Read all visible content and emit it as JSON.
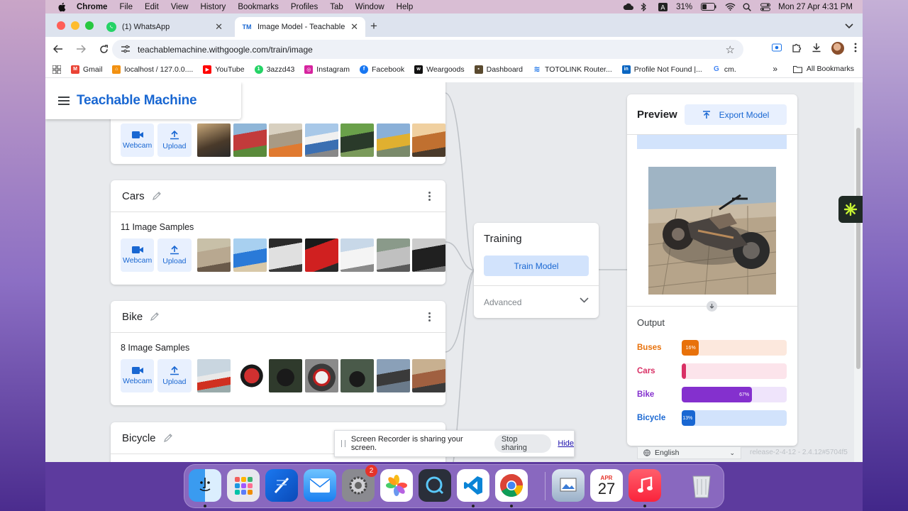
{
  "menubar": {
    "app": "Chrome",
    "items": [
      "File",
      "Edit",
      "View",
      "History",
      "Bookmarks",
      "Profiles",
      "Tab",
      "Window",
      "Help"
    ],
    "battery": "31%",
    "clock": "Mon 27 Apr  4:31 PM"
  },
  "tabs": [
    {
      "title": "(1) WhatsApp",
      "favicon": "whatsapp-icon"
    },
    {
      "title": "Image Model - Teachable Machine",
      "favicon": "teachable-machine-icon",
      "favicon_text": "TM"
    }
  ],
  "address": {
    "url": "teachablemachine.withgoogle.com/train/image"
  },
  "bookmarks": [
    {
      "label": "Gmail",
      "icon": "gmail-icon",
      "color": "#ea4335"
    },
    {
      "label": "localhost / 127.0.0....",
      "icon": "phpmyadmin-icon",
      "color": "#f29111"
    },
    {
      "label": "YouTube",
      "icon": "youtube-icon",
      "color": "#ff0000"
    },
    {
      "label": "3azzd43",
      "icon": "whatsapp-icon",
      "color": "#25d366"
    },
    {
      "label": "Instagram",
      "icon": "instagram-icon",
      "color": "#d6249f"
    },
    {
      "label": "Facebook",
      "icon": "facebook-icon",
      "color": "#1877f2"
    },
    {
      "label": "Weargoods",
      "icon": "weargoods-icon",
      "color": "#111111"
    },
    {
      "label": "Dashboard",
      "icon": "dashboard-icon",
      "color": "#5a4a2f"
    },
    {
      "label": "TOTOLINK Router...",
      "icon": "wifi-icon",
      "color": "#1a73e8"
    },
    {
      "label": "Profile Not Found |...",
      "icon": "linkedin-icon",
      "color": "#0a66c2"
    },
    {
      "label": "cm.",
      "icon": "google-icon",
      "color": "#4285f4"
    }
  ],
  "bookmarks_all": "All Bookmarks",
  "app": {
    "brand": "Teachable Machine"
  },
  "classes": [
    {
      "name": "",
      "samples_label": "",
      "thumbs": [
        "#5a4a3a",
        "#c23b3b",
        "#a89a84",
        "#3b6fb2",
        "#4c7a3a",
        "#b88a2a",
        "#c07030"
      ]
    },
    {
      "name": "Cars",
      "samples_label": "11 Image Samples",
      "thumbs": [
        "#b8a890",
        "#4a8ac8",
        "#e0e0e0",
        "#c83030",
        "#e8e8e8",
        "#b0b0b0",
        "#303030"
      ]
    },
    {
      "name": "Bike",
      "samples_label": "8 Image Samples",
      "thumbs": [
        "#c9d6e0",
        "#d03030",
        "#2f3a2c",
        "#8a8a8a",
        "#4a5a4a",
        "#6a7a8a",
        "#a06040"
      ]
    },
    {
      "name": "Bicycle",
      "samples_label": "",
      "thumbs": []
    }
  ],
  "buttons": {
    "webcam": "Webcam",
    "upload": "Upload"
  },
  "training": {
    "title": "Training",
    "train_button": "Train Model",
    "advanced": "Advanced"
  },
  "preview": {
    "title": "Preview",
    "export_button": "Export Model"
  },
  "output": {
    "title": "Output",
    "rows": [
      {
        "label": "Buses",
        "percent": 16,
        "text": "16%",
        "color": "#e8710a",
        "track": "#fce8dd"
      },
      {
        "label": "Cars",
        "percent": 1,
        "text": "",
        "color": "#d93065",
        "track": "#fce4eb"
      },
      {
        "label": "Bike",
        "percent": 67,
        "text": "67%",
        "color": "#8430ce",
        "track": "#efe4fb"
      },
      {
        "label": "Bicycle",
        "percent": 13,
        "text": "13%",
        "color": "#1967d2",
        "track": "#d2e3fc"
      }
    ]
  },
  "footer": {
    "language": "English",
    "release": "release-2-4-12 - 2.4.12#5704f5"
  },
  "share_bar": {
    "message": "Screen Recorder is sharing your screen.",
    "stop": "Stop sharing",
    "hide": "Hide"
  },
  "dock": {
    "apps": [
      "finder-icon",
      "launchpad-icon",
      "xcode-icon",
      "mail-icon",
      "system-settings-icon",
      "photos-icon",
      "quicktime-icon",
      "vscode-icon",
      "chrome-icon",
      "preview-icon",
      "calendar-icon",
      "music-icon",
      "trash-icon"
    ],
    "calendar_month": "APR",
    "calendar_day": "27",
    "settings_badge": "2"
  }
}
